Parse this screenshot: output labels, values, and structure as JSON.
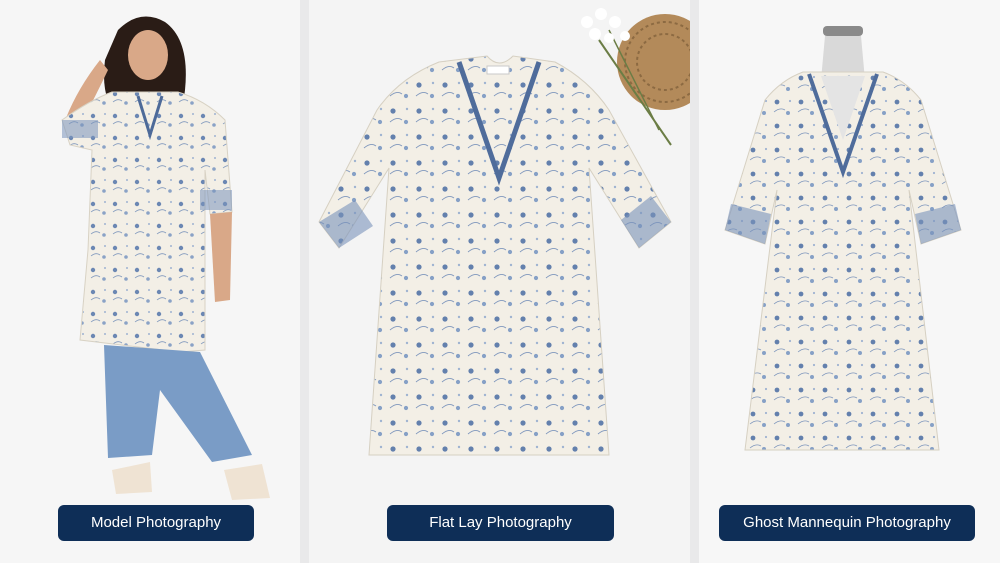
{
  "panels": [
    {
      "caption": "Model Photography"
    },
    {
      "caption": "Flat Lay Photography"
    },
    {
      "caption": "Ghost Mannequin Photography"
    }
  ],
  "colors": {
    "caption_bg": "#0e2e57",
    "fabric": "#f3efe6",
    "print": "#5a78a6",
    "denim": "#7a9cc6"
  }
}
